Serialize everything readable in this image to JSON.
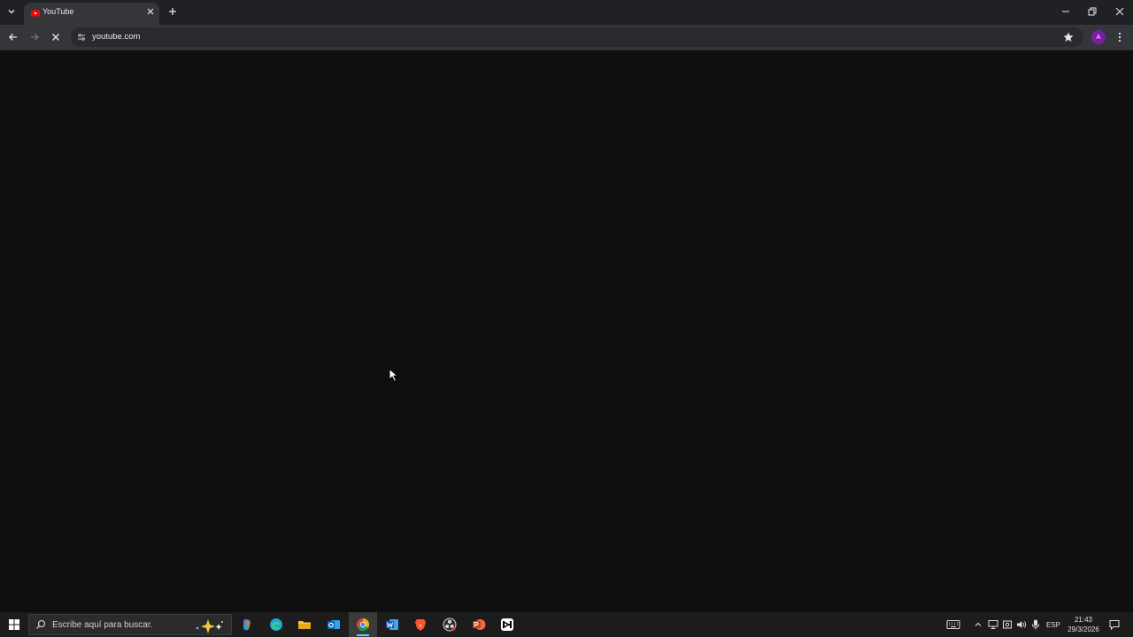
{
  "browser": {
    "tab": {
      "title": "YouTube"
    },
    "toolbar": {
      "url": "youtube.com"
    },
    "profile": {
      "initial": "A"
    }
  },
  "taskbar": {
    "search_placeholder": "Escribe aquí para buscar.",
    "apps": [
      "copilot-icon",
      "edge-icon",
      "file-explorer-icon",
      "outlook-icon",
      "chrome-icon",
      "word-icon",
      "brave-icon",
      "obs-icon",
      "powerpoint-icon",
      "capcut-icon"
    ],
    "language": "ESP",
    "time": "21:43",
    "date": "29/3/2026"
  },
  "colors": {
    "page_bg": "#0f0f0f",
    "tabstrip_bg": "#202124",
    "toolbar_bg": "#35363a",
    "taskbar_bg": "#1c1c1c",
    "accent": "#60cdff",
    "youtube_red": "#ff0000"
  }
}
